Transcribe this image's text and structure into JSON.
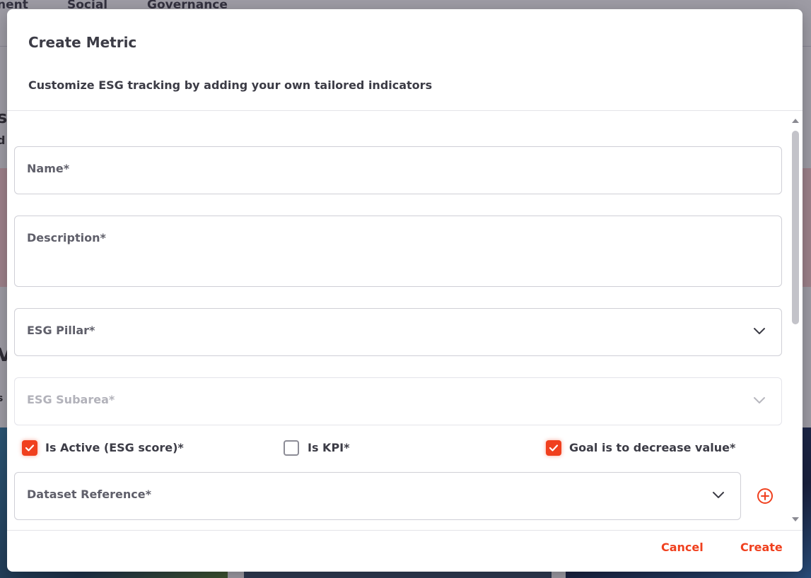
{
  "background": {
    "tabs": [
      "nent",
      "Social",
      "Governance"
    ],
    "side_letters": [
      "s",
      "d",
      "V",
      "s"
    ]
  },
  "modal": {
    "title": "Create Metric",
    "subtitle": "Customize ESG tracking by adding your own tailored indicators",
    "fields": {
      "name": "Name*",
      "description": "Description*",
      "esg_pillar": "ESG Pillar*",
      "esg_subarea": "ESG Subarea*",
      "dataset_reference": "Dataset Reference*"
    },
    "checkboxes": [
      {
        "label": "Is Active (ESG score)*",
        "checked": true
      },
      {
        "label": "Is KPI*",
        "checked": false
      },
      {
        "label": "Goal is to decrease value*",
        "checked": true
      }
    ],
    "buttons": {
      "cancel": "Cancel",
      "create": "Create"
    }
  },
  "colors": {
    "accent": "#f0401e",
    "text": "#3c3c46",
    "border": "#cfcfd6"
  },
  "icons": {
    "dropdown": "chevron-down-icon",
    "add": "add-circle-icon",
    "check": "checkmark-icon"
  }
}
